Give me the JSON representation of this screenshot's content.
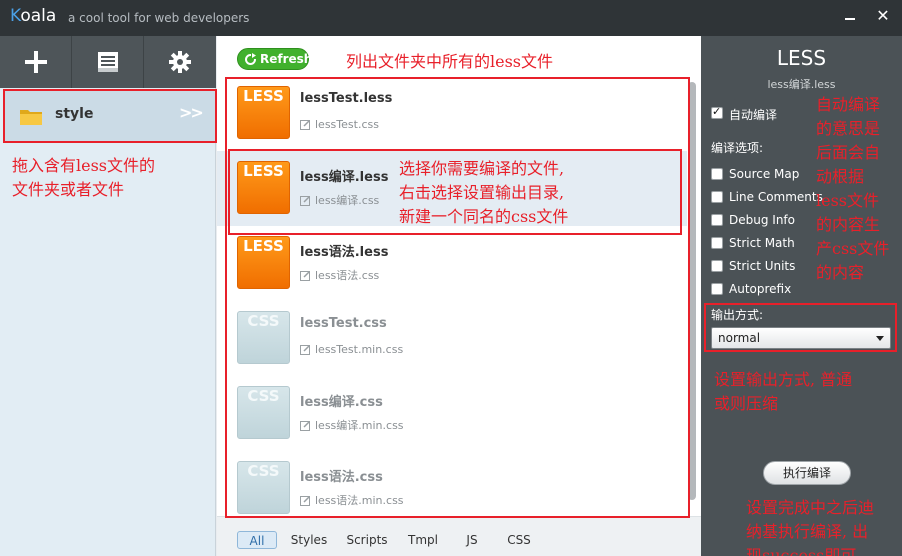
{
  "titlebar": {
    "app_name_first": "K",
    "app_name_rest": "oala",
    "tagline": "a cool tool for web developers",
    "close_glyph": "✕"
  },
  "sidebar": {
    "toolbar_icons": [
      "add-icon",
      "log-icon",
      "settings-icon"
    ],
    "folder": {
      "label": "style",
      "arrow": ">>"
    }
  },
  "filepanel": {
    "refresh_label": "Refresh",
    "files": [
      {
        "badge": "LESS",
        "type": "less",
        "name": "lessTest.less",
        "output": "lessTest.css"
      },
      {
        "badge": "LESS",
        "type": "less",
        "name": "less编译.less",
        "output": "less编译.css"
      },
      {
        "badge": "LESS",
        "type": "less",
        "name": "less语法.less",
        "output": "less语法.css"
      },
      {
        "badge": "CSS",
        "type": "css",
        "name": "lessTest.css",
        "output": "lessTest.min.css"
      },
      {
        "badge": "CSS",
        "type": "css",
        "name": "less编译.css",
        "output": "less编译.min.css"
      },
      {
        "badge": "CSS",
        "type": "css",
        "name": "less语法.css",
        "output": "less语法.min.css"
      }
    ],
    "tabs": [
      "All",
      "Styles",
      "Scripts",
      "Tmpl",
      "JS",
      "CSS"
    ],
    "active_tab": "All"
  },
  "settings": {
    "title": "LESS",
    "file": "less编译.less",
    "auto_compile": {
      "label": "自动编译",
      "checked": true
    },
    "options_label": "编译选项:",
    "options": [
      {
        "label": "Source Map",
        "checked": false
      },
      {
        "label": "Line Comments",
        "checked": false
      },
      {
        "label": "Debug Info",
        "checked": false
      },
      {
        "label": "Strict Math",
        "checked": false
      },
      {
        "label": "Strict Units",
        "checked": false
      },
      {
        "label": "Autoprefix",
        "checked": false
      }
    ],
    "output_label": "输出方式:",
    "output_value": "normal",
    "compile_button": "执行编译"
  },
  "annotations": {
    "list_files": "列出文件夹中所有的less文件",
    "drag_folder": [
      "拖入含有less文件的",
      "文件夹或者文件"
    ],
    "select_file": [
      "选择你需要编译的文件,",
      "右击选择设置输出目录,",
      "新建一个同名的css文件"
    ],
    "auto_compile": [
      "自动编译",
      "的意思是",
      "后面会自",
      "动根据",
      "less文件",
      "的内容生",
      "产css文件",
      "的内容"
    ],
    "output_mode": [
      "设置输出方式, 普通",
      "或则压缩"
    ],
    "compile": [
      "设置完成中之后迪",
      "纳基执行编译, 出",
      "现success即可"
    ]
  },
  "colors": {
    "annotation": "#e8202a",
    "accent_blue": "#4aa0e6",
    "refresh_green": "#41b12d",
    "less_orange": "#f58a0b"
  }
}
